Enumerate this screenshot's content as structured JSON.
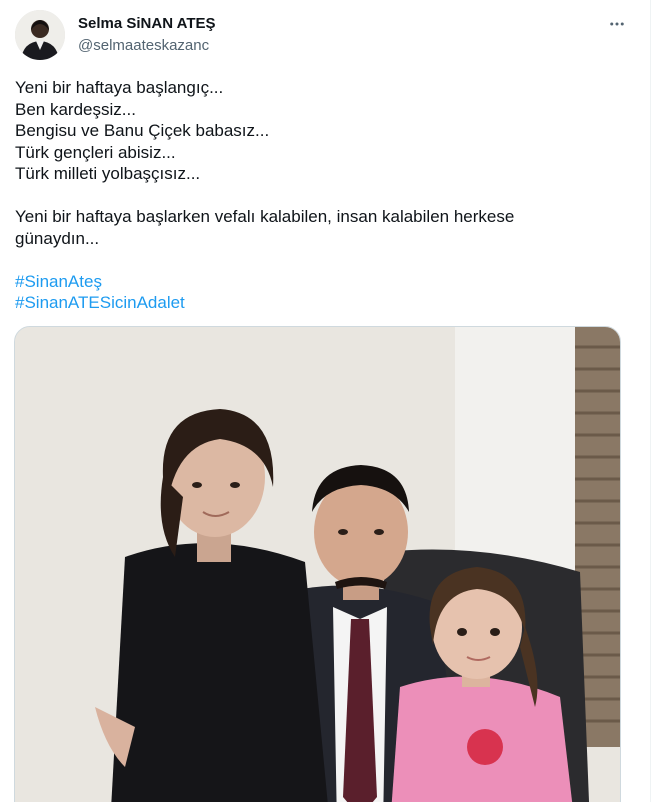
{
  "author": {
    "display_name": "Selma SiNAN ATEŞ",
    "handle": "@selmaateskazanc",
    "avatar_icon": "profile-avatar"
  },
  "menu": {
    "icon": "more-horizontal-icon"
  },
  "tweet": {
    "lines": [
      "Yeni bir haftaya başlangıç...",
      "Ben kardeşsiz...",
      "Bengisu ve Banu Çiçek babasız...",
      "Türk gençleri abisiz...",
      "Türk milleti yolbaşçısız..."
    ],
    "paragraph2": [
      "Yeni bir haftaya başlarken vefalı kalabilen, insan kalabilen herkese",
      "günaydın..."
    ],
    "hashtags": [
      "#SinanAteş",
      "#SinanATESicinAdalet"
    ]
  },
  "media": {
    "type": "photo",
    "description_icon": "photo-three-people"
  },
  "colors": {
    "link": "#1d9bf0",
    "secondary_text": "#536471",
    "primary_text": "#0f1419",
    "border": "#cfd9de"
  }
}
